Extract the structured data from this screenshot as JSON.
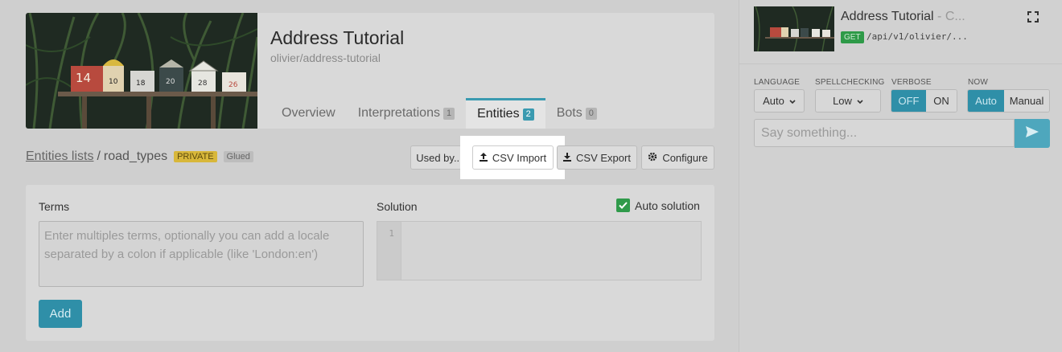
{
  "agent": {
    "title": "Address Tutorial",
    "slug": "olivier/address-tutorial",
    "tabs": [
      {
        "label": "Overview",
        "count": null
      },
      {
        "label": "Interpretations",
        "count": "1"
      },
      {
        "label": "Entities",
        "count": "2"
      },
      {
        "label": "Bots",
        "count": "0"
      }
    ],
    "mailbox_numbers": [
      "14",
      "10",
      "18",
      "20",
      "28",
      "26"
    ]
  },
  "breadcrumb": {
    "link": "Entities lists",
    "separator": "/",
    "current": "road_types",
    "badge_private": "PRIVATE",
    "badge_glued": "Glued"
  },
  "toolbar": {
    "used_by": "Used by...",
    "csv_import": "CSV Import",
    "csv_export": "CSV Export",
    "configure": "Configure"
  },
  "form": {
    "terms_label": "Terms",
    "terms_placeholder": "Enter multiples terms, optionally you can add a locale separated by a colon if applicable (like 'London:en')",
    "solution_label": "Solution",
    "line_number": "1",
    "auto_solution_label": "Auto solution",
    "add_label": "Add"
  },
  "console": {
    "title": "Address Tutorial",
    "title_suffix": " - C...",
    "method": "GET",
    "endpoint": "/api/v1/olivier/...",
    "language_label": "LANGUAGE",
    "language_value": "Auto",
    "spellchecking_label": "SPELLCHECKING",
    "spellchecking_value": "Low",
    "verbose_label": "VERBOSE",
    "verbose_off": "OFF",
    "verbose_on": "ON",
    "now_label": "NOW",
    "now_auto": "Auto",
    "now_manual": "Manual",
    "say_placeholder": "Say something..."
  },
  "colors": {
    "accent": "#2f8fa8",
    "check_green": "#2f9a4a",
    "private_badge": "#d8b73a"
  }
}
